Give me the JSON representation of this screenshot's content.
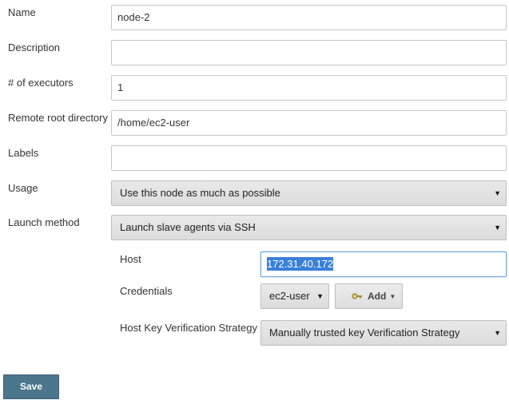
{
  "fields": {
    "name": {
      "label": "Name",
      "value": "node-2"
    },
    "description": {
      "label": "Description",
      "value": ""
    },
    "executors": {
      "label": "# of executors",
      "value": "1"
    },
    "remote_root": {
      "label": "Remote root directory",
      "value": "/home/ec2-user"
    },
    "labels": {
      "label": "Labels",
      "value": ""
    },
    "usage": {
      "label": "Usage",
      "value": "Use this node as much as possible"
    },
    "launch_method": {
      "label": "Launch method",
      "value": "Launch slave agents via SSH"
    }
  },
  "ssh": {
    "host": {
      "label": "Host",
      "value": "172.31.40.172"
    },
    "credentials": {
      "label": "Credentials",
      "value": "ec2-user",
      "add_label": "Add"
    },
    "host_key": {
      "label": "Host Key Verification Strategy",
      "value": "Manually trusted key Verification Strategy"
    }
  },
  "icons": {
    "dropdown_caret": "▼",
    "add_caret": "▼",
    "key_icon": "key-icon"
  },
  "colors": {
    "save_button": "#4b758b",
    "selection": "#3a7fd9",
    "focus_border": "#6aa7d8"
  },
  "actions": {
    "save_label": "Save"
  }
}
